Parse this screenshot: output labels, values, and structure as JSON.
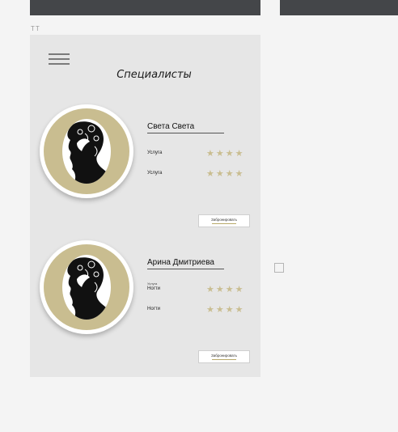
{
  "frame_label": "ТТ",
  "screen_title": "Специалисты",
  "colors": {
    "accent": "#c9bd90",
    "topbar": "#444649",
    "artboard": "#e6e6e6"
  },
  "icons": {
    "menu": "hamburger-menu-icon",
    "avatar": "woman-silhouette-icon",
    "rating": "star-icon"
  },
  "specialists": [
    {
      "name": "Света Света",
      "note": "",
      "services": [
        {
          "label": "Услуга",
          "stars": "★★★★"
        },
        {
          "label": "Услуга",
          "stars": "★★★★"
        }
      ],
      "book_label": "Забронировать"
    },
    {
      "name": "Арина Дмитриева",
      "note": "Услуга",
      "services": [
        {
          "label": "Ногти",
          "stars": "★★★★"
        },
        {
          "label": "Ногти",
          "stars": "★★★★"
        }
      ],
      "book_label": "Забронировать"
    }
  ]
}
